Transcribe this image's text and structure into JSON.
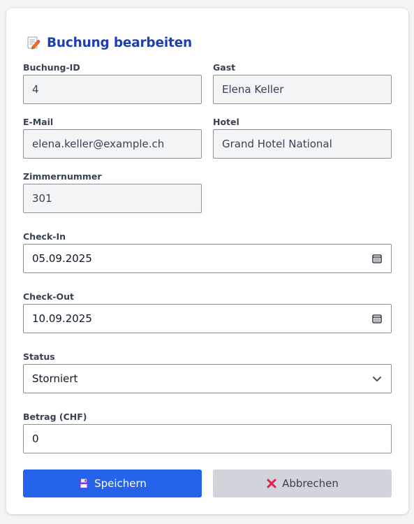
{
  "header": {
    "title": "Buchung bearbeiten",
    "icon": "memo-pencil-icon"
  },
  "form": {
    "booking_id": {
      "label": "Buchung-ID",
      "value": "4"
    },
    "guest": {
      "label": "Gast",
      "value": "Elena Keller"
    },
    "email": {
      "label": "E-Mail",
      "value": "elena.keller@example.ch"
    },
    "hotel": {
      "label": "Hotel",
      "value": "Grand Hotel National"
    },
    "room": {
      "label": "Zimmernummer",
      "value": "301"
    },
    "checkin": {
      "label": "Check-In",
      "value": "05.09.2025",
      "icon": "calendar-icon"
    },
    "checkout": {
      "label": "Check-Out",
      "value": "10.09.2025",
      "icon": "calendar-icon"
    },
    "status": {
      "label": "Status",
      "value": "Storniert",
      "icon": "chevron-down-icon"
    },
    "amount": {
      "label": "Betrag (CHF)",
      "value": "0"
    }
  },
  "actions": {
    "save_label": "Speichern",
    "save_icon": "floppy-disk-icon",
    "cancel_label": "Abbrechen",
    "cancel_icon": "cross-mark-icon"
  },
  "colors": {
    "accent": "#2563eb",
    "title": "#1e40af",
    "readonly_bg": "#f3f4f6",
    "cancel_bg": "#d1d5db"
  }
}
